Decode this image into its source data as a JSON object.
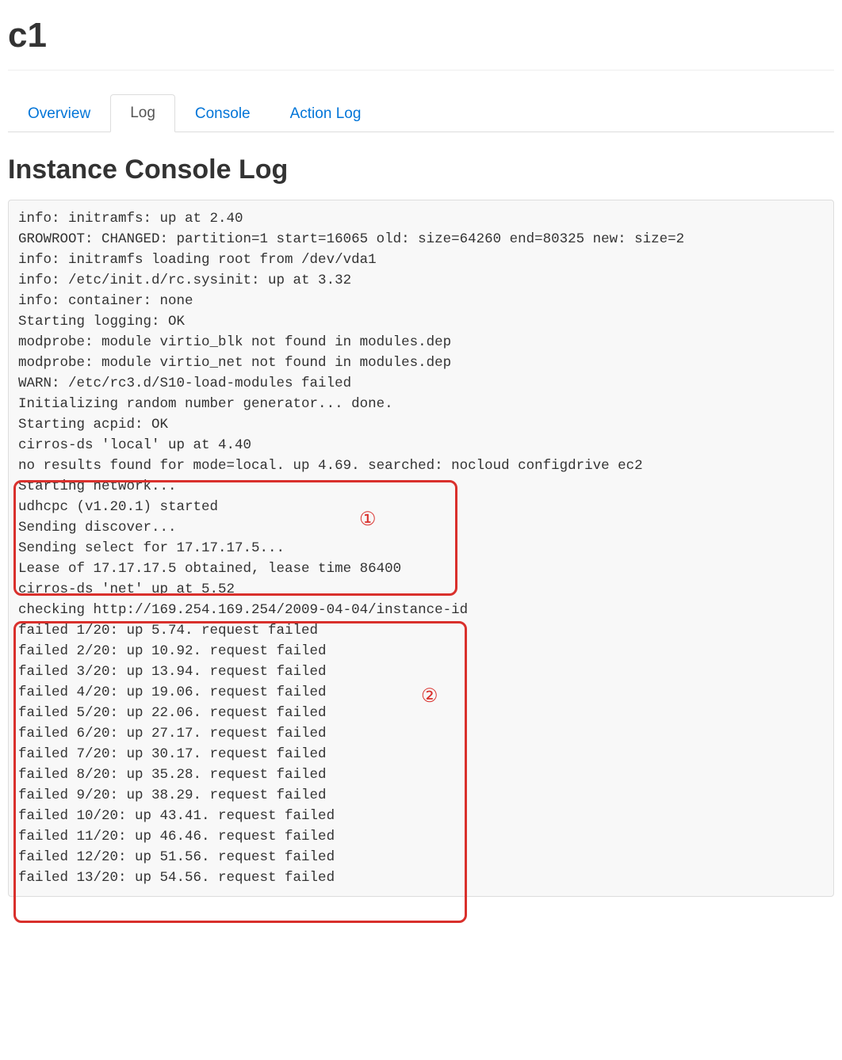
{
  "page_title": "c1",
  "tabs": [
    {
      "label": "Overview",
      "active": false
    },
    {
      "label": "Log",
      "active": true
    },
    {
      "label": "Console",
      "active": false
    },
    {
      "label": "Action Log",
      "active": false
    }
  ],
  "section_title": "Instance Console Log",
  "annotations": {
    "marker1": "①",
    "marker2": "②"
  },
  "log_lines": [
    "info: initramfs: up at 2.40",
    "GROWROOT: CHANGED: partition=1 start=16065 old: size=64260 end=80325 new: size=2",
    "info: initramfs loading root from /dev/vda1",
    "info: /etc/init.d/rc.sysinit: up at 3.32",
    "info: container: none",
    "Starting logging: OK",
    "modprobe: module virtio_blk not found in modules.dep",
    "modprobe: module virtio_net not found in modules.dep",
    "WARN: /etc/rc3.d/S10-load-modules failed",
    "Initializing random number generator... done.",
    "Starting acpid: OK",
    "cirros-ds 'local' up at 4.40",
    "no results found for mode=local. up 4.69. searched: nocloud configdrive ec2",
    "Starting network...",
    "udhcpc (v1.20.1) started",
    "Sending discover...",
    "Sending select for 17.17.17.5...",
    "Lease of 17.17.17.5 obtained, lease time 86400",
    "cirros-ds 'net' up at 5.52",
    "checking http://169.254.169.254/2009-04-04/instance-id",
    "failed 1/20: up 5.74. request failed",
    "failed 2/20: up 10.92. request failed",
    "failed 3/20: up 13.94. request failed",
    "failed 4/20: up 19.06. request failed",
    "failed 5/20: up 22.06. request failed",
    "failed 6/20: up 27.17. request failed",
    "failed 7/20: up 30.17. request failed",
    "failed 8/20: up 35.28. request failed",
    "failed 9/20: up 38.29. request failed",
    "failed 10/20: up 43.41. request failed",
    "failed 11/20: up 46.46. request failed",
    "failed 12/20: up 51.56. request failed",
    "failed 13/20: up 54.56. request failed"
  ]
}
